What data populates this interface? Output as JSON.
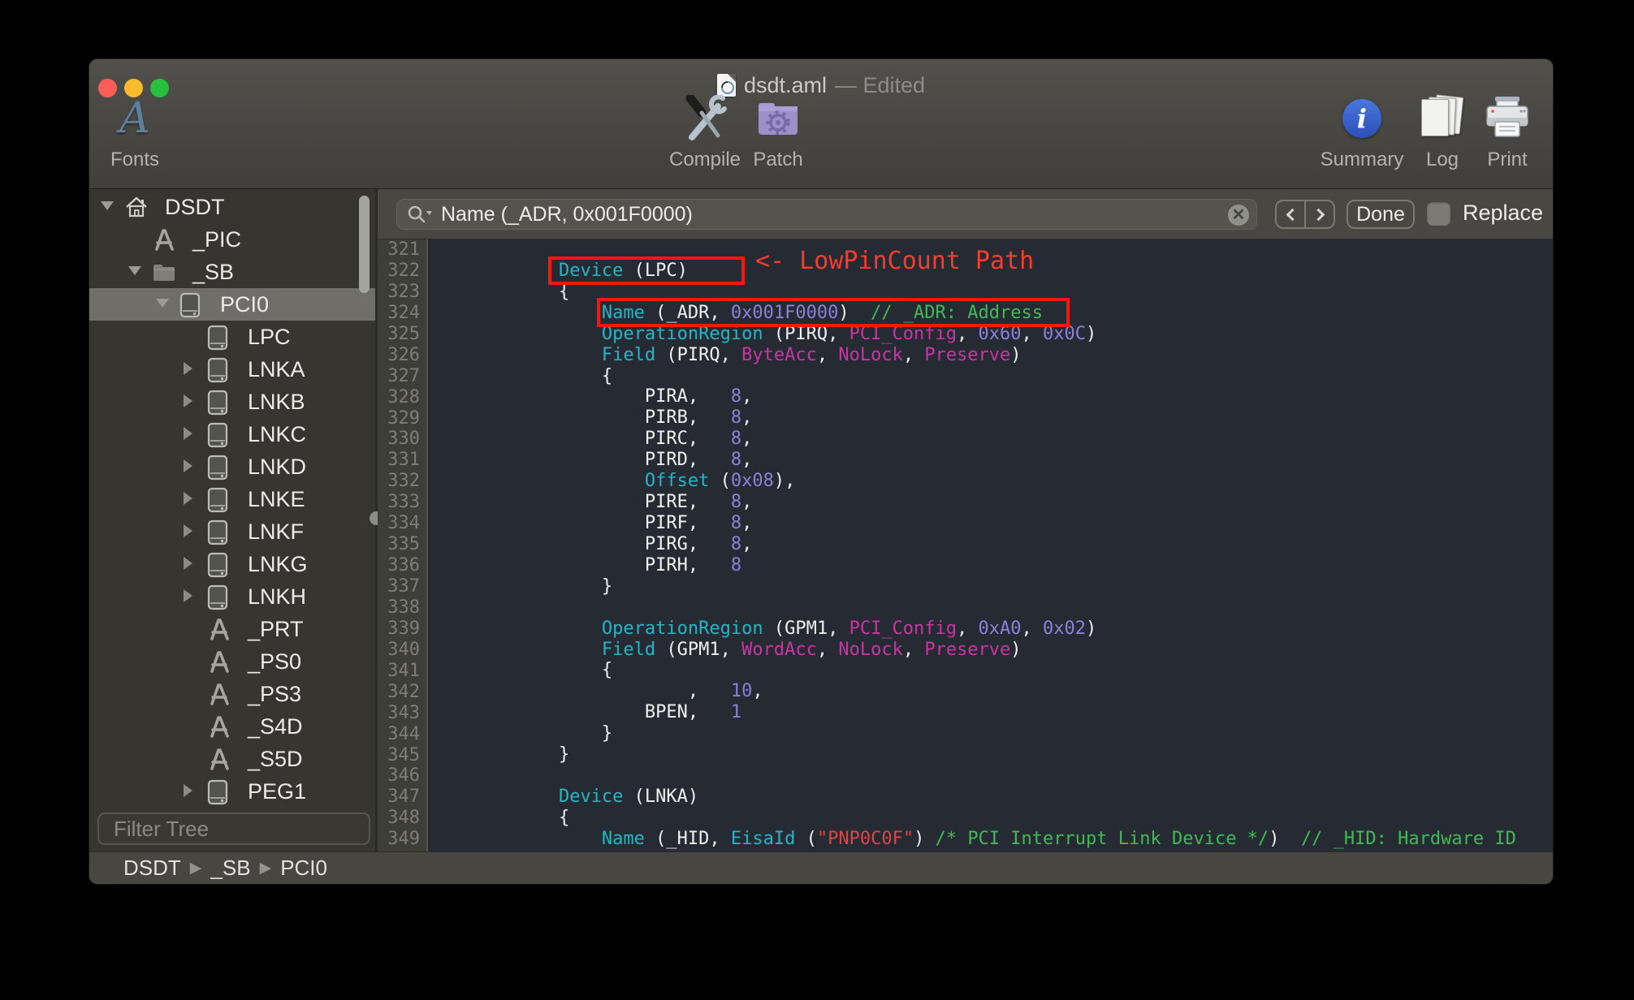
{
  "window": {
    "filename": "dsdt.aml",
    "edited_suffix": "— Edited"
  },
  "toolbar": {
    "items": [
      {
        "label": "Fonts"
      },
      {
        "label": "Compile"
      },
      {
        "label": "Patch"
      },
      {
        "label": "Summary"
      },
      {
        "label": "Log"
      },
      {
        "label": "Print"
      }
    ]
  },
  "findbar": {
    "query": "Name (_ADR, 0x001F0000)",
    "done_label": "Done",
    "replace_label": "Replace"
  },
  "sidebar": {
    "filter_placeholder": "Filter Tree",
    "items": [
      {
        "label": "DSDT",
        "icon": "home-icon",
        "depth": 0,
        "disclosure": "open",
        "selected": false
      },
      {
        "label": "_PIC",
        "icon": "method-icon",
        "depth": 1,
        "disclosure": null,
        "selected": false
      },
      {
        "label": "_SB",
        "icon": "folder-icon",
        "depth": 1,
        "disclosure": "open",
        "selected": false
      },
      {
        "label": "PCI0",
        "icon": "device-icon",
        "depth": 2,
        "disclosure": "open",
        "selected": true
      },
      {
        "label": "LPC",
        "icon": "device-icon",
        "depth": 3,
        "disclosure": null,
        "selected": false
      },
      {
        "label": "LNKA",
        "icon": "device-icon",
        "depth": 3,
        "disclosure": "closed",
        "selected": false
      },
      {
        "label": "LNKB",
        "icon": "device-icon",
        "depth": 3,
        "disclosure": "closed",
        "selected": false
      },
      {
        "label": "LNKC",
        "icon": "device-icon",
        "depth": 3,
        "disclosure": "closed",
        "selected": false
      },
      {
        "label": "LNKD",
        "icon": "device-icon",
        "depth": 3,
        "disclosure": "closed",
        "selected": false
      },
      {
        "label": "LNKE",
        "icon": "device-icon",
        "depth": 3,
        "disclosure": "closed",
        "selected": false
      },
      {
        "label": "LNKF",
        "icon": "device-icon",
        "depth": 3,
        "disclosure": "closed",
        "selected": false
      },
      {
        "label": "LNKG",
        "icon": "device-icon",
        "depth": 3,
        "disclosure": "closed",
        "selected": false
      },
      {
        "label": "LNKH",
        "icon": "device-icon",
        "depth": 3,
        "disclosure": "closed",
        "selected": false
      },
      {
        "label": "_PRT",
        "icon": "method-icon",
        "depth": 3,
        "disclosure": null,
        "selected": false
      },
      {
        "label": "_PS0",
        "icon": "method-icon",
        "depth": 3,
        "disclosure": null,
        "selected": false
      },
      {
        "label": "_PS3",
        "icon": "method-icon",
        "depth": 3,
        "disclosure": null,
        "selected": false
      },
      {
        "label": "_S4D",
        "icon": "method-icon",
        "depth": 3,
        "disclosure": null,
        "selected": false
      },
      {
        "label": "_S5D",
        "icon": "method-icon",
        "depth": 3,
        "disclosure": null,
        "selected": false
      },
      {
        "label": "PEG1",
        "icon": "device-icon",
        "depth": 3,
        "disclosure": "closed",
        "selected": false
      }
    ]
  },
  "statusbar": {
    "path": [
      "DSDT",
      "_SB",
      "PCI0"
    ]
  },
  "editor": {
    "annotation": "<- LowPinCount Path",
    "palette": {
      "kw": "#23b6c7",
      "type": "#c935a4",
      "num": "#8b80da",
      "com": "#3fba54",
      "str": "#e04443",
      "plain": "#eff1f1",
      "annotation_red": "#f93b2c",
      "box_red": "#fb160c",
      "editor_bg": "#262b33",
      "line_number": "#7e7e76"
    },
    "lines": [
      {
        "no": 321,
        "segs": []
      },
      {
        "no": 322,
        "segs": [
          [
            "plain",
            "            "
          ],
          [
            "kw",
            "Device"
          ],
          [
            "plain",
            " (LPC)"
          ]
        ]
      },
      {
        "no": 323,
        "segs": [
          [
            "plain",
            "            {"
          ]
        ]
      },
      {
        "no": 324,
        "segs": [
          [
            "plain",
            "                "
          ],
          [
            "kw",
            "Name"
          ],
          [
            "plain",
            " (_ADR, "
          ],
          [
            "num",
            "0x001F0000"
          ],
          [
            "plain",
            ")  "
          ],
          [
            "com",
            "// _ADR: Address"
          ]
        ]
      },
      {
        "no": 325,
        "segs": [
          [
            "plain",
            "                "
          ],
          [
            "kw",
            "OperationRegion"
          ],
          [
            "plain",
            " (PIRQ, "
          ],
          [
            "type",
            "PCI_Config"
          ],
          [
            "plain",
            ", "
          ],
          [
            "num",
            "0x60"
          ],
          [
            "plain",
            ", "
          ],
          [
            "num",
            "0x0C"
          ],
          [
            "plain",
            ")"
          ]
        ]
      },
      {
        "no": 326,
        "segs": [
          [
            "plain",
            "                "
          ],
          [
            "kw",
            "Field"
          ],
          [
            "plain",
            " (PIRQ, "
          ],
          [
            "type",
            "ByteAcc"
          ],
          [
            "plain",
            ", "
          ],
          [
            "type",
            "NoLock"
          ],
          [
            "plain",
            ", "
          ],
          [
            "type",
            "Preserve"
          ],
          [
            "plain",
            ")"
          ]
        ]
      },
      {
        "no": 327,
        "segs": [
          [
            "plain",
            "                {"
          ]
        ]
      },
      {
        "no": 328,
        "segs": [
          [
            "plain",
            "                    PIRA,   "
          ],
          [
            "num",
            "8"
          ],
          [
            "plain",
            ","
          ]
        ]
      },
      {
        "no": 329,
        "segs": [
          [
            "plain",
            "                    PIRB,   "
          ],
          [
            "num",
            "8"
          ],
          [
            "plain",
            ","
          ]
        ]
      },
      {
        "no": 330,
        "segs": [
          [
            "plain",
            "                    PIRC,   "
          ],
          [
            "num",
            "8"
          ],
          [
            "plain",
            ","
          ]
        ]
      },
      {
        "no": 331,
        "segs": [
          [
            "plain",
            "                    PIRD,   "
          ],
          [
            "num",
            "8"
          ],
          [
            "plain",
            ","
          ]
        ]
      },
      {
        "no": 332,
        "segs": [
          [
            "plain",
            "                    "
          ],
          [
            "kw",
            "Offset"
          ],
          [
            "plain",
            " ("
          ],
          [
            "num",
            "0x08"
          ],
          [
            "plain",
            "),"
          ]
        ]
      },
      {
        "no": 333,
        "segs": [
          [
            "plain",
            "                    PIRE,   "
          ],
          [
            "num",
            "8"
          ],
          [
            "plain",
            ","
          ]
        ]
      },
      {
        "no": 334,
        "segs": [
          [
            "plain",
            "                    PIRF,   "
          ],
          [
            "num",
            "8"
          ],
          [
            "plain",
            ","
          ]
        ]
      },
      {
        "no": 335,
        "segs": [
          [
            "plain",
            "                    PIRG,   "
          ],
          [
            "num",
            "8"
          ],
          [
            "plain",
            ","
          ]
        ]
      },
      {
        "no": 336,
        "segs": [
          [
            "plain",
            "                    PIRH,   "
          ],
          [
            "num",
            "8"
          ]
        ]
      },
      {
        "no": 337,
        "segs": [
          [
            "plain",
            "                }"
          ]
        ]
      },
      {
        "no": 338,
        "segs": []
      },
      {
        "no": 339,
        "segs": [
          [
            "plain",
            "                "
          ],
          [
            "kw",
            "OperationRegion"
          ],
          [
            "plain",
            " (GPM1, "
          ],
          [
            "type",
            "PCI_Config"
          ],
          [
            "plain",
            ", "
          ],
          [
            "num",
            "0xA0"
          ],
          [
            "plain",
            ", "
          ],
          [
            "num",
            "0x02"
          ],
          [
            "plain",
            ")"
          ]
        ]
      },
      {
        "no": 340,
        "segs": [
          [
            "plain",
            "                "
          ],
          [
            "kw",
            "Field"
          ],
          [
            "plain",
            " (GPM1, "
          ],
          [
            "type",
            "WordAcc"
          ],
          [
            "plain",
            ", "
          ],
          [
            "type",
            "NoLock"
          ],
          [
            "plain",
            ", "
          ],
          [
            "type",
            "Preserve"
          ],
          [
            "plain",
            ")"
          ]
        ]
      },
      {
        "no": 341,
        "segs": [
          [
            "plain",
            "                {"
          ]
        ]
      },
      {
        "no": 342,
        "segs": [
          [
            "plain",
            "                        ,   "
          ],
          [
            "num",
            "10"
          ],
          [
            "plain",
            ","
          ]
        ]
      },
      {
        "no": 343,
        "segs": [
          [
            "plain",
            "                    BPEN,   "
          ],
          [
            "num",
            "1"
          ]
        ]
      },
      {
        "no": 344,
        "segs": [
          [
            "plain",
            "                }"
          ]
        ]
      },
      {
        "no": 345,
        "segs": [
          [
            "plain",
            "            }"
          ]
        ]
      },
      {
        "no": 346,
        "segs": []
      },
      {
        "no": 347,
        "segs": [
          [
            "plain",
            "            "
          ],
          [
            "kw",
            "Device"
          ],
          [
            "plain",
            " (LNKA)"
          ]
        ]
      },
      {
        "no": 348,
        "segs": [
          [
            "plain",
            "            {"
          ]
        ]
      },
      {
        "no": 349,
        "segs": [
          [
            "plain",
            "                "
          ],
          [
            "kw",
            "Name"
          ],
          [
            "plain",
            " (_HID, "
          ],
          [
            "kw",
            "EisaId"
          ],
          [
            "plain",
            " ("
          ],
          [
            "str",
            "\"PNP0C0F\""
          ],
          [
            "plain",
            ") "
          ],
          [
            "com",
            "/* PCI Interrupt Link Device */"
          ],
          [
            "plain",
            ")  "
          ],
          [
            "com",
            "// _HID: Hardware ID"
          ]
        ]
      }
    ]
  }
}
